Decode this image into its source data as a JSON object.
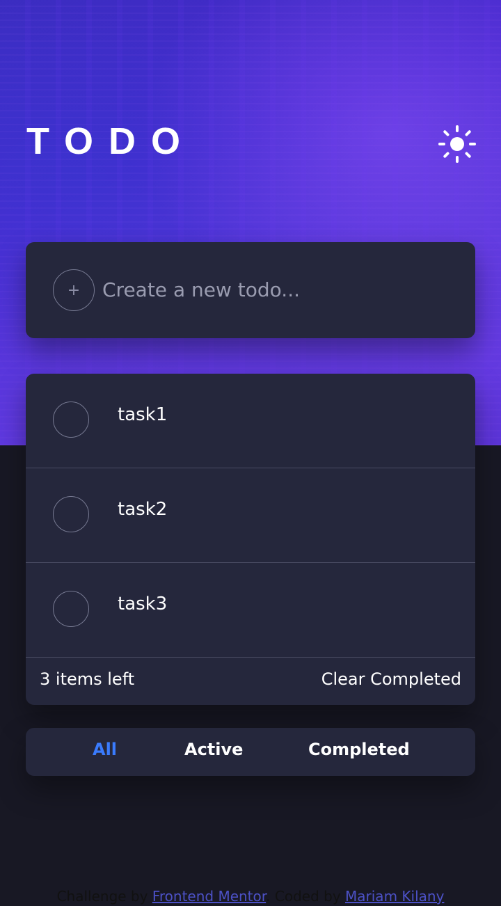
{
  "header": {
    "title": "TODO",
    "theme_toggle_icon": "sun-icon"
  },
  "new_todo": {
    "placeholder": "Create a new todo...",
    "add_icon": "plus-icon",
    "add_symbol": "+"
  },
  "tasks": [
    {
      "label": "task1",
      "completed": false
    },
    {
      "label": "task2",
      "completed": false
    },
    {
      "label": "task3",
      "completed": false
    }
  ],
  "list_footer": {
    "items_left": "3 items left",
    "clear_label": "Clear Completed"
  },
  "filters": {
    "all": "All",
    "active": "Active",
    "completed": "Completed",
    "selected": "all"
  },
  "attribution": {
    "prefix": "Challenge by ",
    "link1": "Frontend Mentor",
    "middle": ". Coded by ",
    "link2": "Mariam Kilany"
  },
  "colors": {
    "page_bg": "#181824",
    "card_bg": "#25273c",
    "accent": "#3a7bfd",
    "hero_purple": "#4a2bd0"
  }
}
